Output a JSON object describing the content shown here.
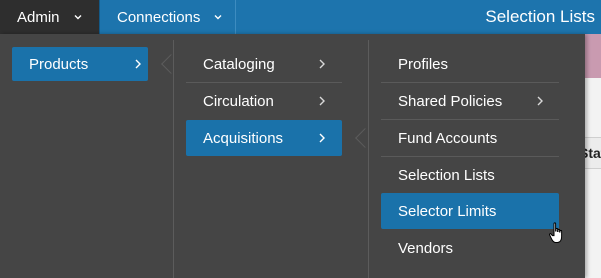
{
  "nav": {
    "admin_label": "Admin",
    "connections_label": "Connections",
    "page_title": "Selection Lists"
  },
  "background": {
    "column_header_fragment": "Statu"
  },
  "menu": {
    "col1": [
      {
        "label": "Products",
        "active": true,
        "has_submenu": true
      }
    ],
    "col2": [
      {
        "label": "Cataloging",
        "has_submenu": true
      },
      {
        "label": "Circulation",
        "has_submenu": true
      },
      {
        "label": "Acquisitions",
        "active": true,
        "has_submenu": true
      }
    ],
    "col3": [
      {
        "label": "Profiles"
      },
      {
        "label": "Shared Policies",
        "has_submenu": true
      },
      {
        "label": "Fund Accounts"
      },
      {
        "label": "Selection Lists"
      },
      {
        "label": "Selector Limits",
        "hovered": true
      },
      {
        "label": "Vendors"
      }
    ]
  },
  "colors": {
    "nav_bar": "#1d74ad",
    "admin_tab": "#2e2e2e",
    "menu_bg": "#454545",
    "active_item": "#1a72aa",
    "page_strip": "#c99ab0"
  },
  "icons": {
    "dropdown": "chevron-down-icon",
    "submenu": "chevron-right-icon",
    "pointer": "hand-pointer-cursor-icon"
  }
}
